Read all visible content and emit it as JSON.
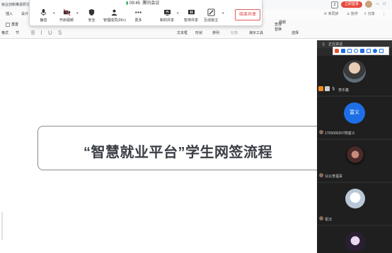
{
  "wps": {
    "doc_title": "就业创新推进研讨会",
    "menu": [
      "插入",
      "设计"
    ],
    "right_badge": "2",
    "login_button": "立即登录",
    "right_actions": [
      "未同步",
      "协作",
      "分享"
    ],
    "ribbon_left": [
      "重置",
      "格式",
      "节"
    ],
    "ribbon_mid": [
      "文本框",
      "形状",
      "排列",
      "轮廓"
    ],
    "ribbon_right": [
      "查找",
      "替换",
      "演示工具",
      "选择",
      "视频"
    ]
  },
  "meeting": {
    "time": "09:45",
    "title": "腾讯会议",
    "buttons": [
      {
        "icon": "microphone-icon",
        "label": "静音"
      },
      {
        "icon": "camera-off-icon",
        "label": "开启视频"
      },
      {
        "icon": "shield-icon",
        "label": "安全"
      },
      {
        "icon": "people-icon",
        "label": "管理成员(39+)"
      },
      {
        "icon": "more-icon",
        "label": "更多"
      },
      {
        "icon": "screen-share-icon",
        "label": "新的共享"
      },
      {
        "icon": "pause-icon",
        "label": "暂停共享"
      },
      {
        "icon": "annotate-icon",
        "label": "互动批注"
      }
    ],
    "end_share": "结束共享"
  },
  "slide": {
    "title": "“智慧就业平台”学生网签流程"
  },
  "panel": {
    "speaking_label": "正在讲话",
    "participants": [
      {
        "name": "李乐鑫",
        "avatar_text": ""
      },
      {
        "name": "1705000207杨富义",
        "avatar_text": "富义"
      },
      {
        "name": "1111李福青",
        "avatar_text": ""
      },
      {
        "name": "祝汉",
        "avatar_text": ""
      },
      {
        "name": "",
        "avatar_text": ""
      }
    ]
  },
  "colors": {
    "accent_blue": "#1e6fe6",
    "end_red": "#e03a3a",
    "panel_bg": "#1f1f1f"
  }
}
